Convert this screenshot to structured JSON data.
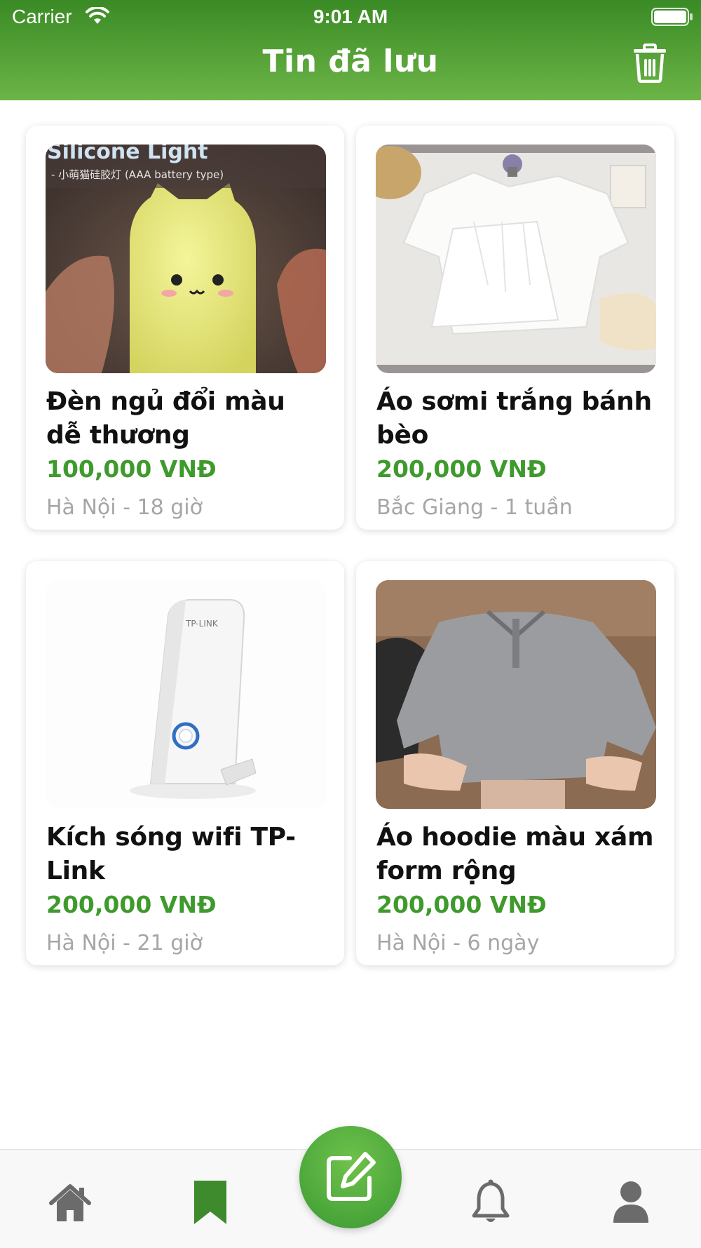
{
  "status_bar": {
    "carrier": "Carrier",
    "time": "9:01 AM"
  },
  "header": {
    "title": "Tin đã lưu",
    "action_icon": "trash-icon"
  },
  "colors": {
    "header_green": "#4c9a30",
    "price_green": "#3f9a2d",
    "tab_active": "#3d8b2c",
    "tab_inactive": "#6b6b6b"
  },
  "items": [
    {
      "title": "Đèn ngủ đổi màu dễ thương",
      "price": "100,000 VNĐ",
      "meta": "Hà Nội - 18 giờ",
      "image_text": "Silicone Light",
      "image_subtext": "- 小萌猫硅胶灯 (AAA battery type)"
    },
    {
      "title": "Áo sơmi trắng bánh bèo",
      "price": "200,000 VNĐ",
      "meta": "Bắc Giang - 1 tuần"
    },
    {
      "title": "Kích sóng wifi TP-Link",
      "price": "200,000 VNĐ",
      "meta": "Hà Nội - 21 giờ",
      "image_text": "TP-LINK"
    },
    {
      "title": "Áo hoodie màu xám form rộng",
      "price": "200,000 VNĐ",
      "meta": "Hà Nội - 6 ngày"
    }
  ],
  "tabs": [
    {
      "icon": "home-icon"
    },
    {
      "icon": "bookmark-icon",
      "active": true
    },
    {
      "icon": "edit-icon"
    },
    {
      "icon": "bell-icon"
    },
    {
      "icon": "user-icon"
    }
  ]
}
